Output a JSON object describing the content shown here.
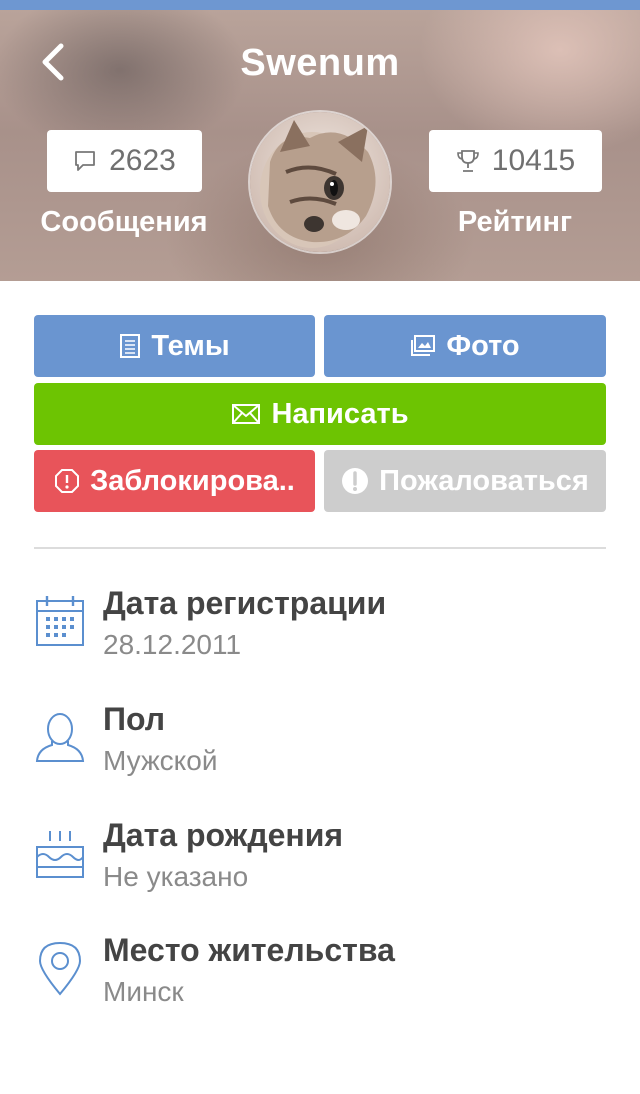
{
  "header": {
    "title": "Swenum",
    "messages": {
      "count": "2623",
      "label": "Сообщения",
      "icon": "speech-bubble-icon"
    },
    "rating": {
      "count": "10415",
      "label": "Рейтинг",
      "icon": "trophy-icon"
    },
    "avatar": "cat-avatar"
  },
  "actions": {
    "topics_label": "Темы",
    "photo_label": "Фото",
    "write_label": "Написать",
    "block_label": "Заблокирова..",
    "report_label": "Пожаловаться"
  },
  "info": {
    "registration": {
      "title": "Дата регистрации",
      "value": "28.12.2011",
      "icon": "calendar-icon"
    },
    "gender": {
      "title": "Пол",
      "value": "Мужской",
      "icon": "person-icon"
    },
    "birthday": {
      "title": "Дата рождения",
      "value": "Не указано",
      "icon": "cake-icon"
    },
    "location": {
      "title": "Место жительства",
      "value": "Минск",
      "icon": "location-pin-icon"
    }
  },
  "colors": {
    "blue": "#6a95d0",
    "green": "#6dc402",
    "red": "#e8545a",
    "grey": "#cdcdcd",
    "icon_blue": "#5b8fcf"
  }
}
